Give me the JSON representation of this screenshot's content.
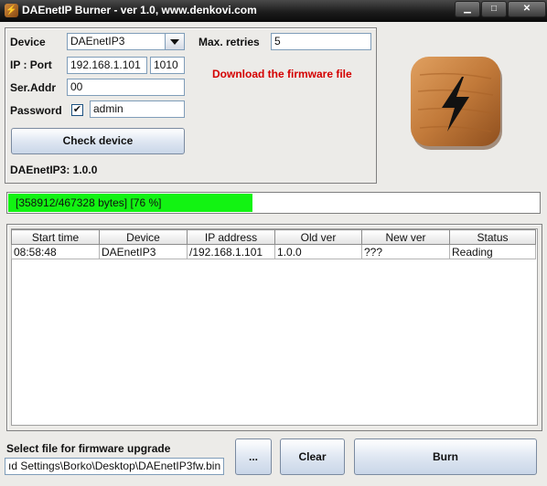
{
  "window": {
    "title": "DAEnetIP Burner - ver 1.0, www.denkovi.com",
    "minimize_icon": "minimize-icon",
    "maximize_icon": "maximize-icon",
    "close_icon": "close-icon"
  },
  "device_panel": {
    "device_label": "Device",
    "device_value": "DAEnetIP3",
    "ip_port_label": "IP : Port",
    "ip_value": "192.168.1.101",
    "port_value": "1010",
    "ser_addr_label": "Ser.Addr",
    "ser_addr_value": "00",
    "password_label": "Password",
    "password_checked": true,
    "password_check_glyph": "✔",
    "password_value": "admin",
    "max_retries_label": "Max. retries",
    "max_retries_value": "5",
    "download_link": "Download the firmware file",
    "check_button": "Check device",
    "device_info": "DAEnetIP3: 1.0.0"
  },
  "app_icon": "lightning-bolt-icon",
  "colors": {
    "progress_fill": "#12f312",
    "link_red": "#d40000",
    "icon_wood": "#c27a3a"
  },
  "progress": {
    "text": "[358912/467328 bytes] [76 %]",
    "fraction": 0.768
  },
  "table": {
    "columns": [
      "Start time",
      "Device",
      "IP address",
      "Old ver",
      "New ver",
      "Status"
    ],
    "rows": [
      [
        "08:58:48",
        "DAEnetIP3",
        "/192.168.1.101",
        "1.0.0",
        "???",
        "Reading"
      ]
    ]
  },
  "bottom": {
    "select_label": "Select file for firmware upgrade",
    "file_path": "ıd Settings\\Borko\\Desktop\\DAEnetIP3fw.bin",
    "browse_button": "...",
    "clear_button": "Clear",
    "burn_button": "Burn"
  }
}
